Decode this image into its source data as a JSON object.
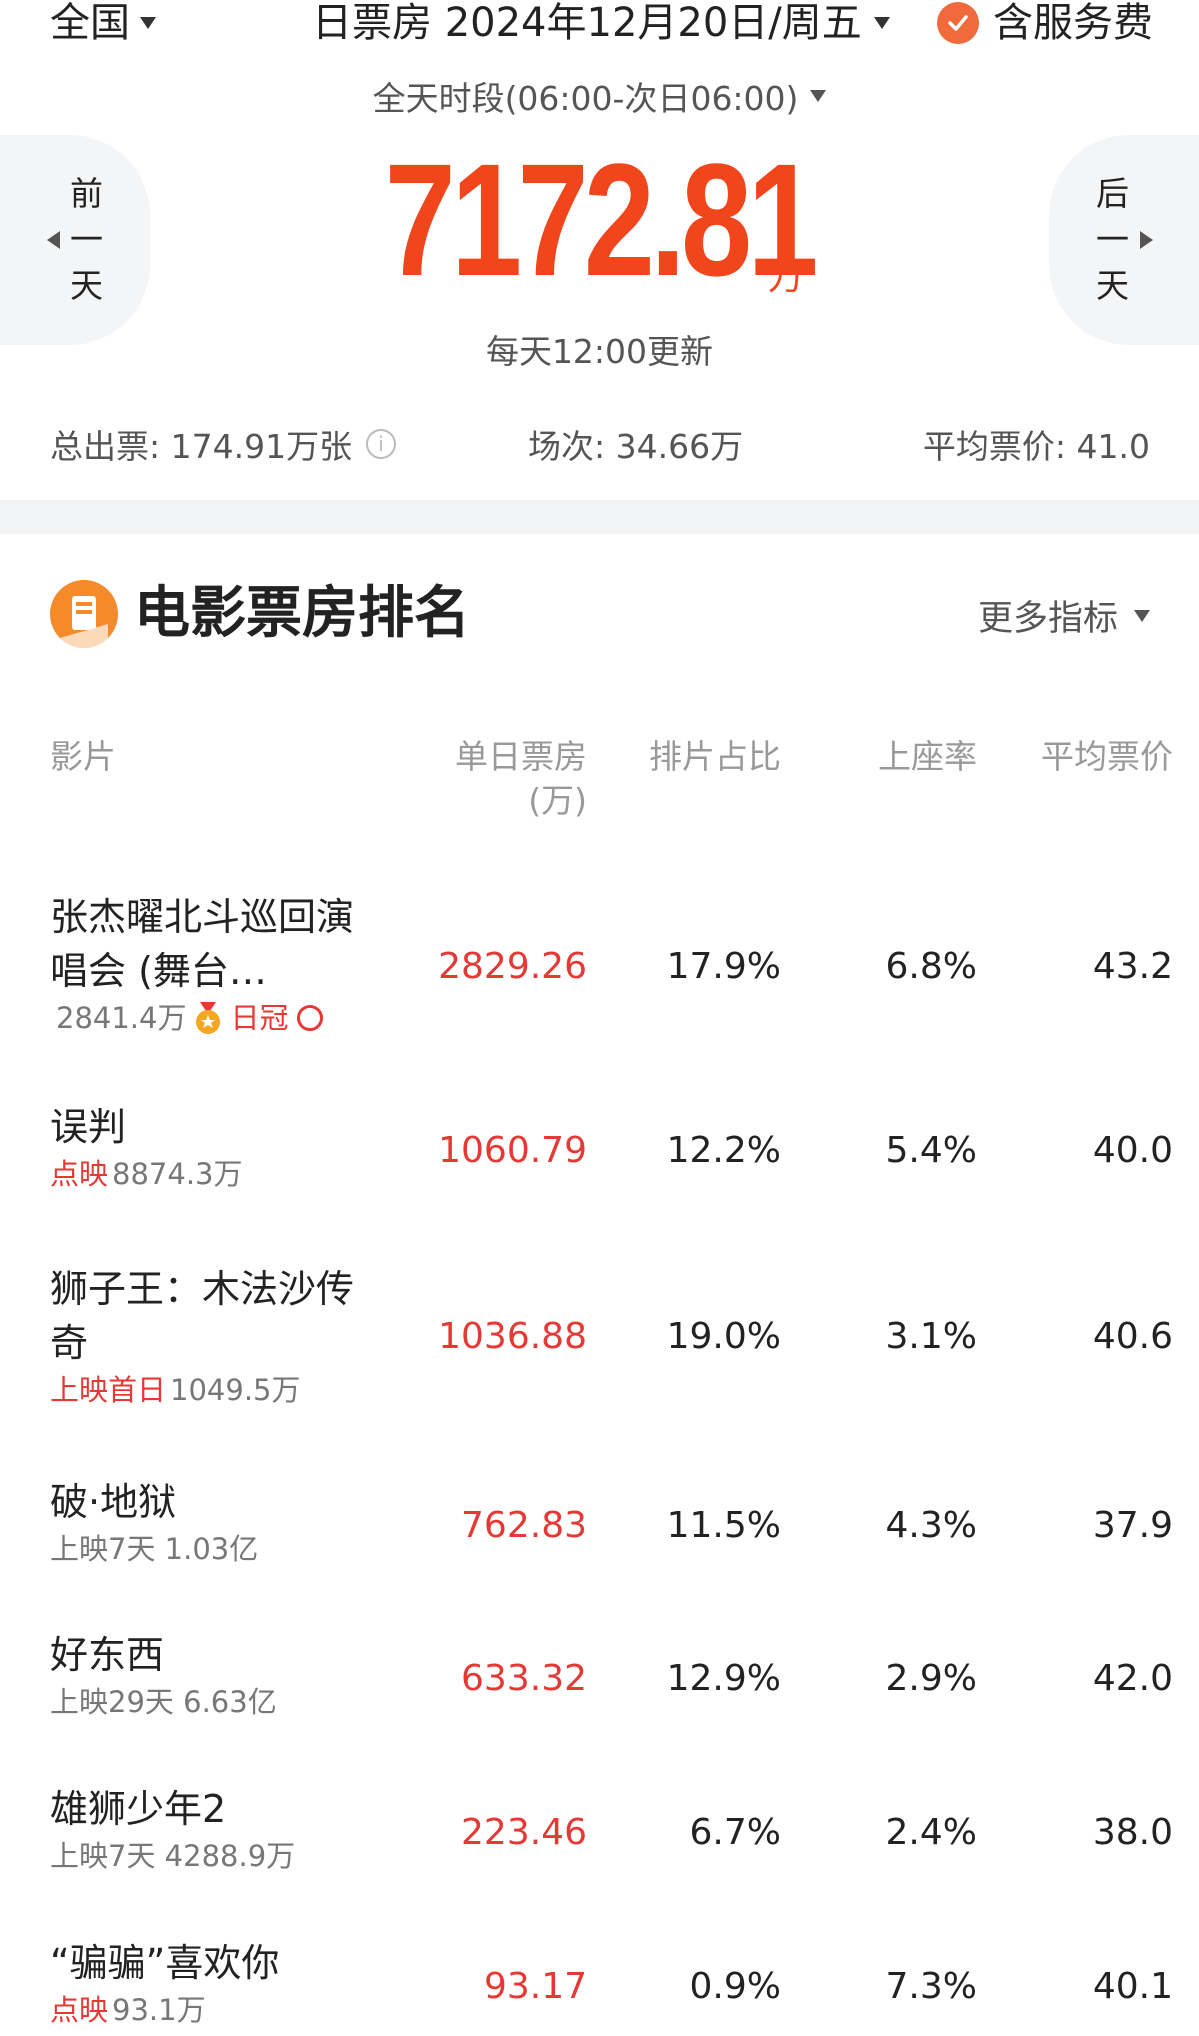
{
  "topbar": {
    "region": "全国",
    "date_label": "日票房 2024年12月20日/周五",
    "service_label": "含服务费"
  },
  "period": "全天时段(06:00-次日06:00)",
  "nav": {
    "prev": "前\n一\n天",
    "next": "后\n一\n天"
  },
  "total": {
    "value": "7172.81",
    "unit": "万",
    "update_note": "每天12:00更新"
  },
  "stats": {
    "tickets": "总出票: 174.91万张",
    "shows": "场次: 34.66万",
    "avg_price": "平均票价: 41.0"
  },
  "section": {
    "title": "电影票房排名",
    "more": "更多指标"
  },
  "columns": {
    "film": "影片",
    "box": "单日票房",
    "box_unit": "(万)",
    "share": "排片占比",
    "seat": "上座率",
    "avg": "平均票价"
  },
  "films": [
    {
      "name": "张杰曜北斗巡回演唱会 (舞台…",
      "tag": "",
      "sub": "2841.4万",
      "crown": "日冠",
      "box": "2829.26",
      "share": "17.9%",
      "seat": "6.8%",
      "avg": "43.2"
    },
    {
      "name": "误判",
      "tag": "点映",
      "sub": "8874.3万",
      "crown": "",
      "box": "1060.79",
      "share": "12.2%",
      "seat": "5.4%",
      "avg": "40.0"
    },
    {
      "name": "狮子王：木法沙传奇",
      "tag": "上映首日",
      "sub": "1049.5万",
      "crown": "",
      "box": "1036.88",
      "share": "19.0%",
      "seat": "3.1%",
      "avg": "40.6"
    },
    {
      "name": "破·地狱",
      "tag": "",
      "sub": "上映7天 1.03亿",
      "crown": "",
      "box": "762.83",
      "share": "11.5%",
      "seat": "4.3%",
      "avg": "37.9"
    },
    {
      "name": "好东西",
      "tag": "",
      "sub": "上映29天 6.63亿",
      "crown": "",
      "box": "633.32",
      "share": "12.9%",
      "seat": "2.9%",
      "avg": "42.0"
    },
    {
      "name": "雄狮少年2",
      "tag": "",
      "sub": "上映7天 4288.9万",
      "crown": "",
      "box": "223.46",
      "share": "6.7%",
      "seat": "2.4%",
      "avg": "38.0"
    },
    {
      "name": "“骗骗”喜欢你",
      "tag": "点映",
      "sub": "93.1万",
      "crown": "",
      "box": "93.17",
      "share": "0.9%",
      "seat": "7.3%",
      "avg": "40.1"
    }
  ],
  "colors": {
    "accent": "#f1461c",
    "box_red": "#e53935",
    "icon_orange": "#f48a2a"
  }
}
